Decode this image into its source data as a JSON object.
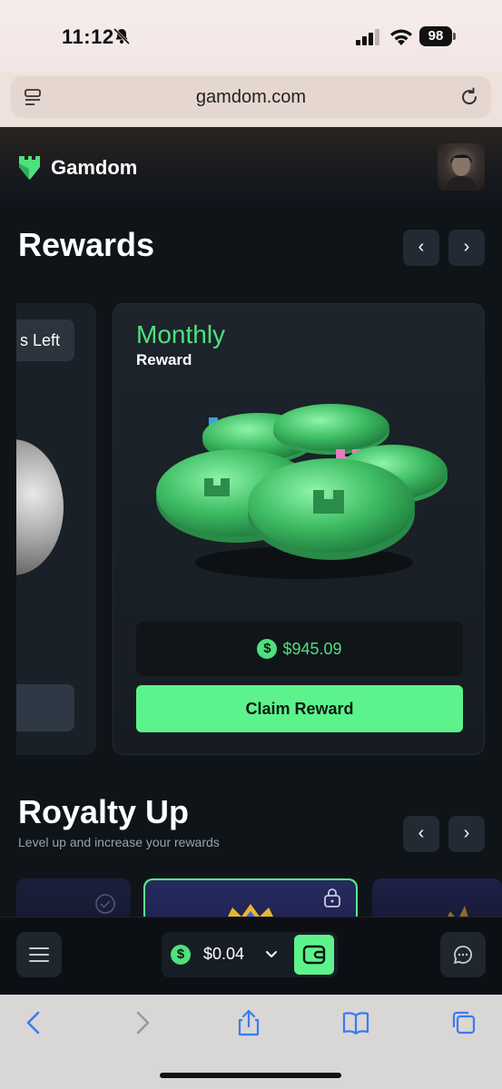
{
  "status_bar": {
    "time": "11:12",
    "battery": "98"
  },
  "browser": {
    "url": "gamdom.com"
  },
  "site": {
    "brand_name": "Gamdom"
  },
  "rewards": {
    "title": "Rewards",
    "prev_label": "‹",
    "next_label": "›",
    "left_card": {
      "time_left_label": "s Left"
    },
    "main_card": {
      "title": "Monthly",
      "subtitle": "Reward",
      "currency_symbol": "$",
      "amount": "$945.09",
      "claim_label": "Claim Reward"
    }
  },
  "royalty": {
    "title": "Royalty Up",
    "subtitle": "Level up and increase your rewards",
    "prev_label": "‹",
    "next_label": "›"
  },
  "dock": {
    "currency_symbol": "$",
    "balance": "$0.04"
  },
  "colors": {
    "accent_green": "#5cf38c",
    "text_green": "#4fe07e",
    "background": "#0f1419",
    "card": "#1a2027"
  }
}
